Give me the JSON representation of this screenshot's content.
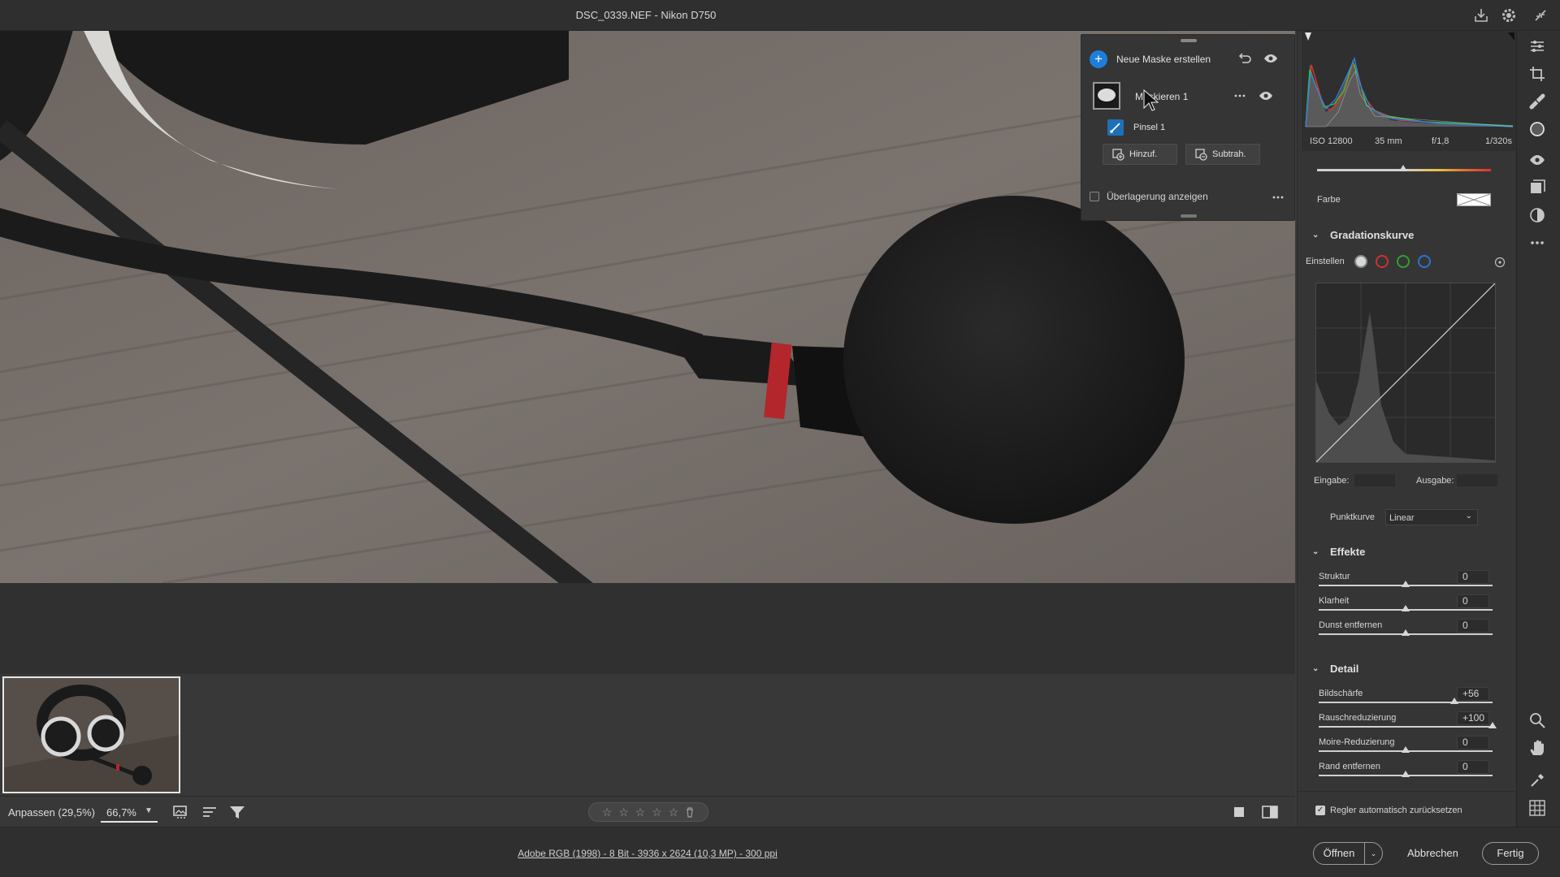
{
  "window": {
    "title": "DSC_0339.NEF - Nikon D750"
  },
  "mask_panel": {
    "create_new_label": "Neue Maske erstellen",
    "mask_name": "Maskieren 1",
    "brush_name": "Pinsel 1",
    "add_button": "Hinzuf.",
    "subtract_button": "Subtrah.",
    "show_overlay_label": "Überlagerung anzeigen",
    "show_overlay_checked": false
  },
  "histogram": {
    "iso": "ISO 12800",
    "focal_length": "35 mm",
    "aperture": "f/1,8",
    "shutter": "1/320s"
  },
  "panel": {
    "color_label": "Farbe",
    "tone_curve": {
      "title": "Gradationskurve",
      "adjust_label": "Einstellen",
      "input_label": "Eingabe:",
      "output_label": "Ausgabe:",
      "point_curve_label": "Punktkurve",
      "point_curve_value": "Linear"
    },
    "effects": {
      "title": "Effekte",
      "sliders": [
        {
          "label": "Struktur",
          "value": "0"
        },
        {
          "label": "Klarheit",
          "value": "0"
        },
        {
          "label": "Dunst entfernen",
          "value": "0"
        }
      ]
    },
    "detail": {
      "title": "Detail",
      "sliders": [
        {
          "label": "Bildschärfe",
          "value": "+56"
        },
        {
          "label": "Rauschreduzierung",
          "value": "+100"
        },
        {
          "label": "Moire-Reduzierung",
          "value": "0"
        },
        {
          "label": "Rand entfernen",
          "value": "0"
        }
      ]
    },
    "auto_reset_label": "Regler automatisch zurücksetzen",
    "auto_reset_checked": true
  },
  "bottom_toolbar": {
    "fit_label": "Anpassen (29,5%)",
    "zoom_value": "66,7%"
  },
  "status": {
    "file_info": "Adobe RGB (1998) - 8 Bit - 3936 x 2624 (10,3 MP) - 300 ppi",
    "open_button": "Öffnen",
    "cancel_button": "Abbrechen",
    "done_button": "Fertig"
  },
  "colors": {
    "accent": "#1e7fd8",
    "panel_bg": "#353535",
    "window_bg": "#2f2f2f"
  },
  "icons": [
    "download-icon",
    "gear-icon",
    "collapse-icon",
    "plus-icon",
    "reset-icon",
    "eye-icon",
    "more-icon",
    "brush-icon",
    "add-mask-icon",
    "subtract-mask-icon",
    "sliders-icon",
    "crop-icon",
    "healing-icon",
    "mask-icon",
    "redeye-icon",
    "snapshots-icon",
    "presets-icon",
    "zoom-icon",
    "hand-icon",
    "sampler-icon",
    "grid-icon",
    "filter-icon",
    "sort-icon",
    "thumbnails-icon",
    "star-icon",
    "trash-icon",
    "single-view-icon",
    "compare-view-icon"
  ]
}
